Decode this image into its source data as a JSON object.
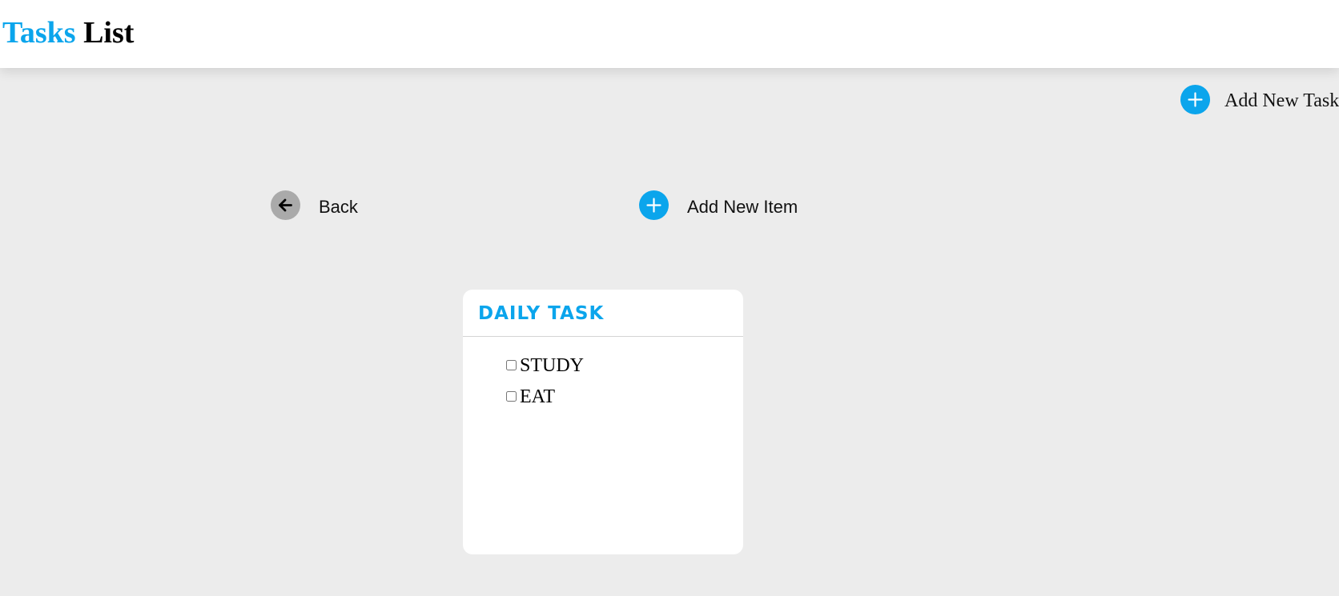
{
  "header": {
    "title_accent": "Tasks",
    "title_rest": "List"
  },
  "toolbar": {
    "add_task_label": "Add New Task",
    "back_label": "Back",
    "add_item_label": "Add New Item"
  },
  "icons": {
    "add_task": "plus-icon",
    "back": "arrow-left-icon",
    "add_item": "plus-icon"
  },
  "card": {
    "title": "DAILY TASK",
    "items": [
      {
        "label": "STUDY",
        "checked": false
      },
      {
        "label": "EAT",
        "checked": false
      }
    ]
  },
  "colors": {
    "accent": "#0ba5ec",
    "background": "#ececec",
    "header_bg": "#ffffff",
    "back_button": "#aaaaaa"
  }
}
